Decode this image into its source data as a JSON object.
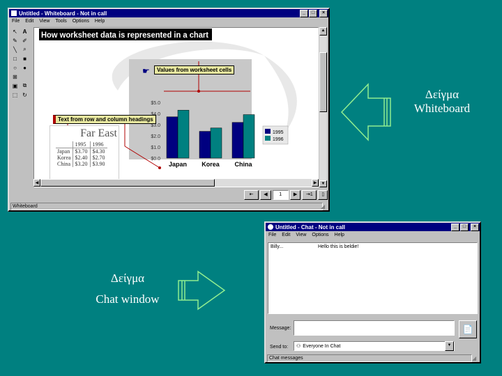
{
  "whiteboard": {
    "title": "Untitled - Whiteboard - Not in call",
    "menu": [
      "File",
      "Edit",
      "View",
      "Tools",
      "Options",
      "Help"
    ],
    "status": "Whiteboard",
    "page_number": "1",
    "page_total": "1",
    "slide_title": "How worksheet data is represented in a chart",
    "callout_values": "Values from worksheet cells",
    "callout_text": "Text from row and column headings",
    "table": {
      "title": "Far East",
      "headers": [
        "",
        "1995",
        "1996"
      ],
      "rows": [
        [
          "Japan",
          "$3.70",
          "$4.30"
        ],
        [
          "Korea",
          "$2.40",
          "$2.70"
        ],
        [
          "China",
          "$3.20",
          "$3.90"
        ]
      ]
    }
  },
  "chart_data": {
    "type": "bar",
    "categories": [
      "Japan",
      "Korea",
      "China"
    ],
    "series": [
      {
        "name": "1995",
        "values": [
          3.7,
          2.4,
          3.2
        ],
        "color": "#000080"
      },
      {
        "name": "1996",
        "values": [
          4.3,
          2.7,
          3.9
        ],
        "color": "#008080"
      }
    ],
    "ytick_labels": [
      "$5.0",
      "$4.0",
      "$3.0",
      "$2.0",
      "$1.0",
      "$0.0"
    ],
    "ylim": [
      0,
      5
    ],
    "legend": "right",
    "grid": false
  },
  "chat": {
    "title": "Untitled - Chat - Not in call",
    "menu": [
      "File",
      "Edit",
      "View",
      "Options",
      "Help"
    ],
    "messages": [
      {
        "sender": "Billy...",
        "text": "Hello this is beldie!"
      }
    ],
    "message_label": "Message:",
    "message_value": "",
    "sendto_label": "Send to:",
    "sendto_value": "Everyone In Chat",
    "status": "Chat messages"
  },
  "captions": {
    "whiteboard_line1": "Δείγμα",
    "whiteboard_line2": "Whiteboard",
    "chat_line1": "Δείγμα",
    "chat_line2": "Chat window"
  },
  "colors": {
    "desktop": "#008080",
    "titlebar": "#000080",
    "arrow": "#90ee90"
  }
}
